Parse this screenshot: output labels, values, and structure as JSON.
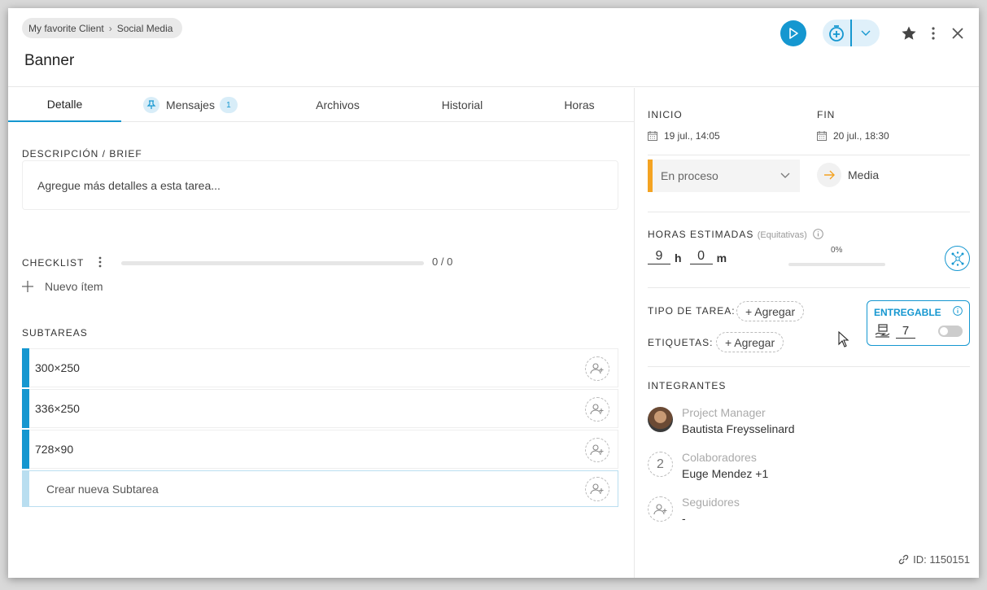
{
  "header": {
    "breadcrumb": [
      "My favorite Client",
      "Social Media"
    ],
    "title": "Banner"
  },
  "tabs": [
    {
      "label": "Detalle"
    },
    {
      "label": "Mensajes",
      "badge": "1"
    },
    {
      "label": "Archivos"
    },
    {
      "label": "Historial"
    },
    {
      "label": "Horas"
    }
  ],
  "detail": {
    "description_label": "DESCRIPCIÓN / BRIEF",
    "description_placeholder": "Agregue más detalles a esta tarea...",
    "checklist_label": "CHECKLIST",
    "checklist_progress": 0,
    "checklist_count": "0 / 0",
    "new_item_label": "Nuevo ítem",
    "subtasks_label": "SUBTAREAS",
    "subtasks": [
      "300×250",
      "336×250",
      "728×90"
    ],
    "new_subtask_label": "Crear nueva Subtarea"
  },
  "side": {
    "start_label": "INICIO",
    "start_value": "19 jul., 14:05",
    "end_label": "FIN",
    "end_value": "20 jul., 18:30",
    "status": "En proceso",
    "status_color": "#f4a322",
    "priority": "Media",
    "hours_label": "HORAS ESTIMADAS",
    "hours_note": "(Equitativas)",
    "hours": "9",
    "hours_unit": "h",
    "minutes": "0",
    "minutes_unit": "m",
    "hours_progress": "0%",
    "task_type_label": "TIPO DE TAREA:",
    "tags_label": "ETIQUETAS:",
    "add_label": "+ Agregar",
    "deliverable_label": "ENTREGABLE",
    "deliverable_count": "7",
    "deliverable_enabled": false,
    "members_label": "INTEGRANTES",
    "members": [
      {
        "role": "Project Manager",
        "name": "Bautista Freysselinard"
      },
      {
        "role": "Colaboradores",
        "name": "Euge Mendez +1",
        "count": "2"
      },
      {
        "role": "Seguidores",
        "name": "-"
      }
    ],
    "id_text": "ID: 1150151"
  },
  "accent_color": "#1597d0"
}
